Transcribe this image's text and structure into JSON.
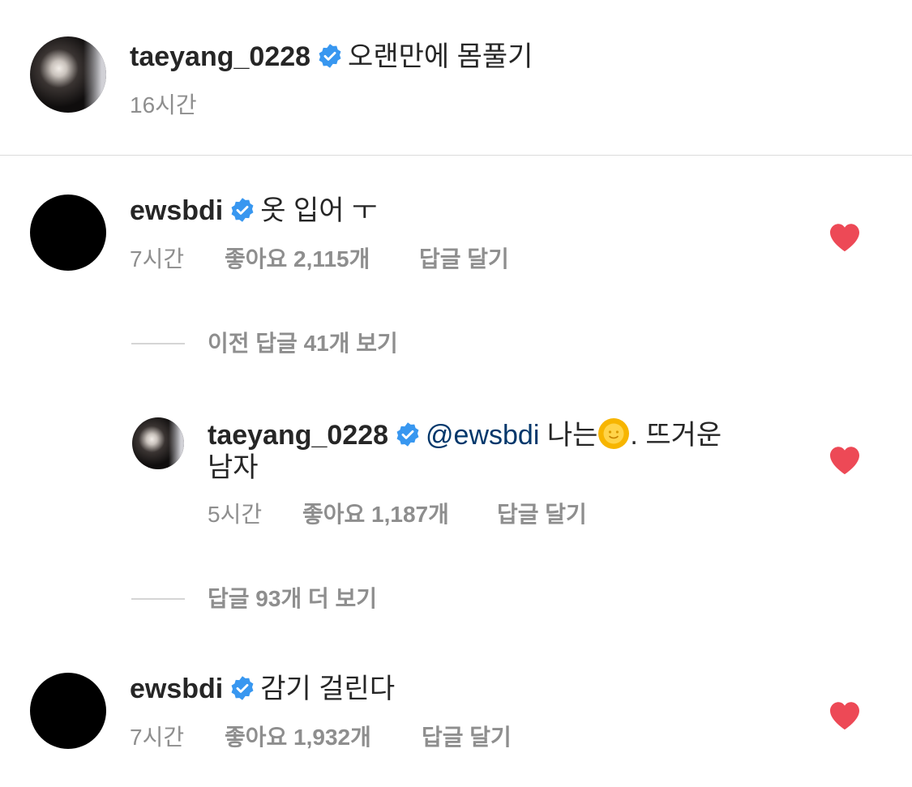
{
  "post": {
    "username": "taeyang_0228",
    "caption": "오랜만에 몸풀기",
    "time": "16시간"
  },
  "comments": [
    {
      "username": "ewsbdi",
      "text": "옷 입어 ㅜ",
      "time": "7시간",
      "likes": "좋아요 2,115개",
      "reply_label": "답글 달기"
    },
    {
      "username": "ewsbdi",
      "text": "감기 걸린다",
      "time": "7시간",
      "likes": "좋아요 1,932개",
      "reply_label": "답글 달기"
    }
  ],
  "view_previous_replies": "이전 답글 41개 보기",
  "reply": {
    "username": "taeyang_0228",
    "mention": "@ewsbdi",
    "text_before_emoji": "나는",
    "emoji": "🌞",
    "text_after_emoji": ". 뜨거운",
    "text_line2": "남자",
    "time": "5시간",
    "likes": "좋아요 1,187개",
    "reply_label": "답글 달기"
  },
  "view_more_replies": "답글 93개 더 보기",
  "colors": {
    "text": "#262626",
    "meta": "#8e8e8e",
    "mention": "#00376b",
    "verified": "#3897f0",
    "heart": "#ed4956"
  }
}
